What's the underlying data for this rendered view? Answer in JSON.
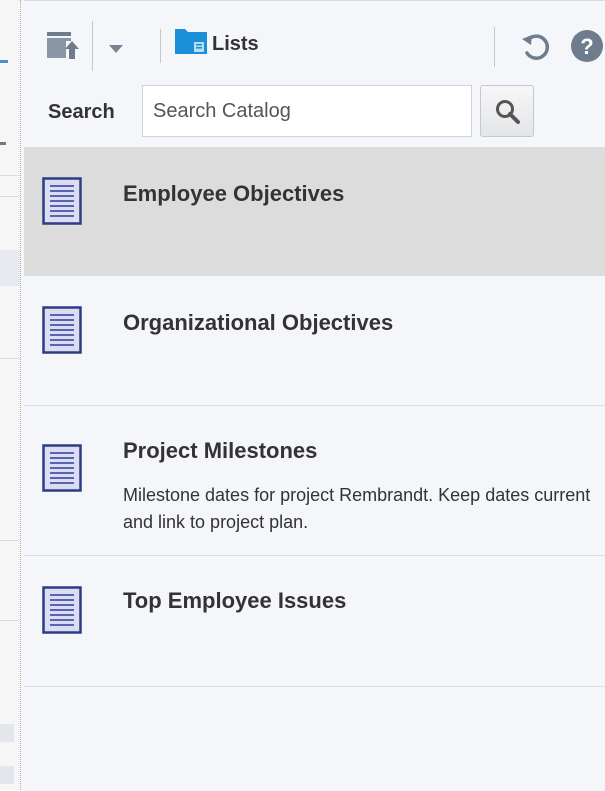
{
  "toolbar": {
    "folder_label": "Lists",
    "icons": [
      "upload-icon",
      "dropdown-arrow-icon",
      "folder-icon",
      "refresh-icon",
      "help-icon"
    ]
  },
  "search": {
    "label": "Search",
    "placeholder": "Search Catalog"
  },
  "catalog_items": [
    {
      "title": "Employee Objectives",
      "description": "",
      "selected": true
    },
    {
      "title": "Organizational Objectives",
      "description": "",
      "selected": false
    },
    {
      "title": "Project Milestones",
      "description": "Milestone dates for project Rembrandt. Keep dates current and link to project plan.",
      "selected": false
    },
    {
      "title": "Top Employee Issues",
      "description": "",
      "selected": false
    }
  ],
  "colors": {
    "panel_bg": "#f4f6fa",
    "selected_bg": "#dcdcdc",
    "folder_blue": "#1b8fd8",
    "list_icon_border": "#2b3d84",
    "list_icon_fill": "#dcdcf3"
  }
}
